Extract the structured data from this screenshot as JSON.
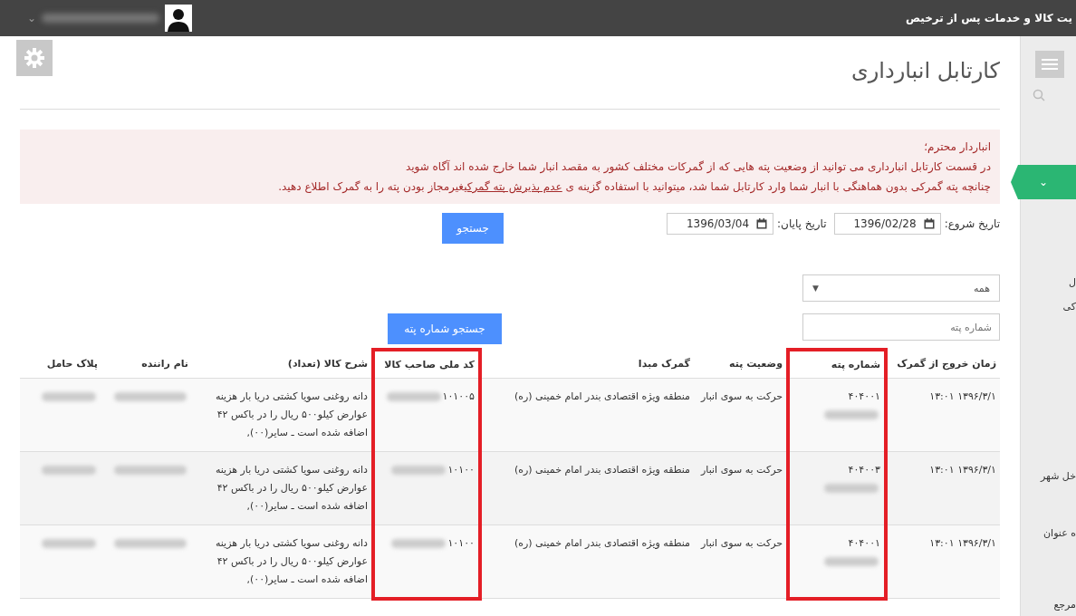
{
  "top_bar": {
    "title": "یت کالا و خدمات پس از ترخیص",
    "user_caret": "⌄"
  },
  "sidebar": {
    "tab_chevron": "⌄",
    "fragments": [
      "ل",
      "کی",
      "خل شهر",
      "ه عنوان",
      "مرجع"
    ]
  },
  "page": {
    "title": "کارتابل انبارداری"
  },
  "notice": {
    "greeting": "انباردار محترم؛",
    "line": "در قسمت کارتابل انبارداری می توانید از وضعیت پته هایی که از گمرکات مختلف کشور به مقصد انبار شما خارج شده اند آگاه شوید",
    "before_link": "چنانچه پته گمرکی بدون هماهنگی با انبار شما وارد کارتابل شما شد، میتوانید با استفاده گزینه ی ",
    "link": "عدم پذیرش پته گمرکی",
    "after_link": "غیرمجاز بودن پته را به گمرک اطلاع دهید."
  },
  "date_filter": {
    "start_label": "تاریخ شروع:",
    "start_value": "1396/02/28",
    "end_label": "تاریخ پایان:",
    "end_value": "1396/03/04",
    "search_button": "جستجو"
  },
  "filters": {
    "status_select": "همه",
    "select_arrow": "▼",
    "number_placeholder": "شماره پته",
    "number_search_button": "جستجو شماره پته"
  },
  "table": {
    "columns": [
      {
        "label": "زمان خروج از گمرک",
        "highlighted": false
      },
      {
        "label": "شماره پته",
        "highlighted": true
      },
      {
        "label": "وضعیت پته",
        "highlighted": false
      },
      {
        "label": "گمرک مبدا",
        "highlighted": false
      },
      {
        "label": "کد ملی صاحب کالا",
        "highlighted": true
      },
      {
        "label": "شرح کالا (تعداد)",
        "highlighted": false
      },
      {
        "label": "نام راننده",
        "highlighted": false
      },
      {
        "label": "پلاک حامل",
        "highlighted": false
      }
    ],
    "rows": [
      {
        "exit_time": "۱۳۹۶/۳/۱ ۱۳:۰۱",
        "number": "۴۰۴۰۰۱",
        "status": "حرکت به سوی انبار",
        "origin": "منطقه ویژه اقتصادی بندر امام خمینی (ره)",
        "owner_code": "۱۰۱۰۰۵",
        "description": "دانه روغنی سویا کشتی دریا بار هزینه عوارض کیلو۵۰۰ ریال را در باکس ۴۲ اضافه شده است ـ سایر(۰۰),"
      },
      {
        "exit_time": "۱۳۹۶/۳/۱ ۱۳:۰۱",
        "number": "۴۰۴۰۰۳",
        "status": "حرکت به سوی انبار",
        "origin": "منطقه ویژه اقتصادی بندر امام خمینی (ره)",
        "owner_code": "۱۰۱۰۰",
        "description": "دانه روغنی سویا کشتی دریا بار هزینه عوارض کیلو۵۰۰ ریال را در باکس ۴۲ اضافه شده است ـ سایر(۰۰),"
      },
      {
        "exit_time": "۱۳۹۶/۳/۱ ۱۳:۰۱",
        "number": "۴۰۴۰۰۱",
        "status": "حرکت به سوی انبار",
        "origin": "منطقه ویژه اقتصادی بندر امام خمینی (ره)",
        "owner_code": "۱۰۱۰۰",
        "description": "دانه روغنی سویا کشتی دریا بار هزینه عوارض کیلو۵۰۰ ریال را در باکس ۴۲ اضافه شده است ـ سایر(۰۰),"
      }
    ]
  }
}
